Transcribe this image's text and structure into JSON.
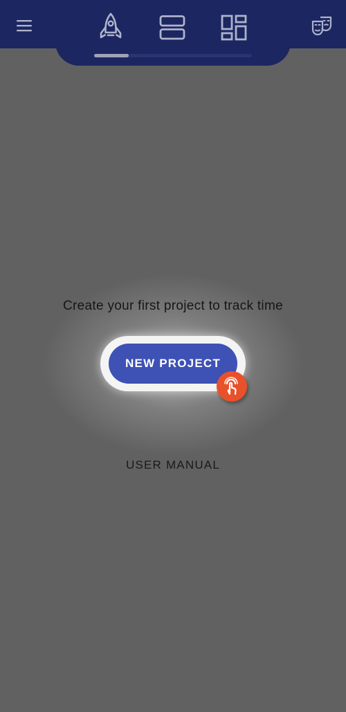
{
  "app_bar": {
    "background": "#1c2660",
    "menu_icon": "hamburger-menu-icon",
    "tabs": [
      {
        "icon": "rocket-icon",
        "selected": true
      },
      {
        "icon": "list-view-icon",
        "selected": false
      },
      {
        "icon": "dashboard-icon",
        "selected": false
      }
    ],
    "theme_icon": "theater-masks-icon"
  },
  "main": {
    "background": "#616161",
    "empty_message": "Create your first project to track time",
    "primary_button_label": "NEW PROJECT",
    "primary_button_color": "#3e51b5",
    "touch_hint_icon": "tap-gesture-icon",
    "touch_hint_color": "#e8512a",
    "secondary_link_label": "USER MANUAL"
  }
}
